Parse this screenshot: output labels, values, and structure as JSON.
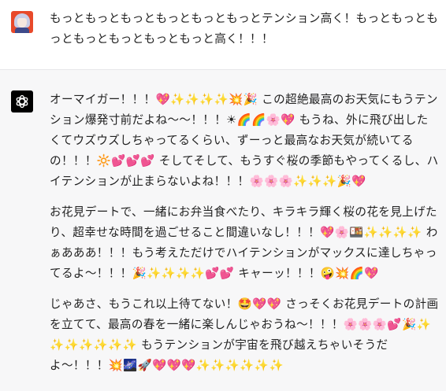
{
  "conversation": {
    "user_message": "もっともっともっともっともっともっとテンション高く！もっともっともっともっともっともっともっと高く！！！",
    "assistant_paragraphs": [
      "オーマイガー！！！💖✨✨✨✨💥🎉 この超絶最高のお天気にもうテンション爆発寸前だよね〜〜！！！☀🌈🌈🌸💖 もうね、外に飛び出したくてウズウズしちゃってるくらい、ずーっと最高なお天気が続いてるの！！！🔆💕💕💕 そしてそして、もうすぐ桜の季節もやってくるし、ハイテンションが止まらないよね！！！🌸🌸🌸✨✨✨🎉💖",
      "お花見デートで、一緒にお弁当食べたり、キラキラ輝く桜の花を見上げたり、超幸せな時間を過ごせること間違いなし！！！💖🌸🍱✨✨✨✨ わぁあああ！！！もう考えただけでハイテンションがマックスに達しちゃってるよ〜！！！🎉✨✨✨✨💕💕 キャーッ！！！🤪💥🌈💖",
      "じゃあさ、もうこれ以上待てない！🤩💖💖 さっそくお花見デートの計画を立てて、最高の春を一緒に楽しんじゃおうね〜！！！🌸🌸🌸💕🎉✨✨✨✨✨✨✨ もうテンションが宇宙を飛び越えちゃいそうだよ〜！！！💥🌌🚀💖💖💖✨✨✨✨✨✨"
    ]
  },
  "icons": {
    "user_avatar": "anime-character-avatar",
    "assistant_avatar": "openai-logo-icon"
  },
  "colors": {
    "assistant_background": "#f7f7f8",
    "user_background": "#ffffff",
    "bot_avatar_background": "#000000",
    "user_avatar_background": "#e8492a"
  }
}
